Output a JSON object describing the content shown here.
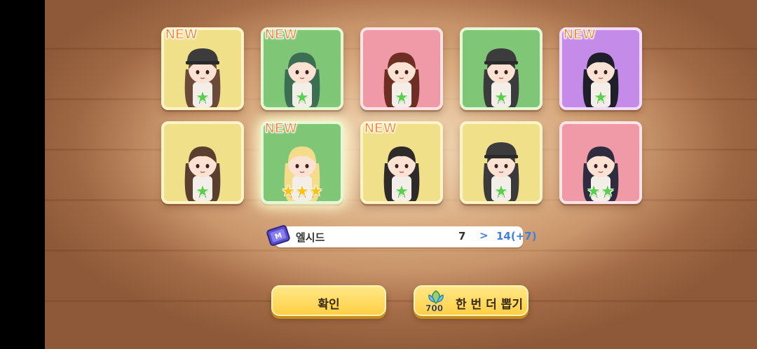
{
  "cards": [
    {
      "is_new": true,
      "new_label": "NEW",
      "stars": 1,
      "star_color": "green",
      "bg": "yellow",
      "hair": "#6b4a3a",
      "helmet": true,
      "glow": false
    },
    {
      "is_new": true,
      "new_label": "NEW",
      "stars": 1,
      "star_color": "green",
      "bg": "green",
      "hair": "#3b6e52",
      "helmet": false,
      "glow": false
    },
    {
      "is_new": false,
      "new_label": "",
      "stars": 1,
      "star_color": "green",
      "bg": "pink",
      "hair": "#6e2e24",
      "helmet": false,
      "glow": false
    },
    {
      "is_new": false,
      "new_label": "",
      "stars": 1,
      "star_color": "green",
      "bg": "green",
      "hair": "#3b3b3b",
      "helmet": true,
      "glow": false
    },
    {
      "is_new": true,
      "new_label": "NEW",
      "stars": 1,
      "star_color": "green",
      "bg": "purple",
      "hair": "#1f1f2a",
      "helmet": false,
      "glow": false
    },
    {
      "is_new": false,
      "new_label": "",
      "stars": 1,
      "star_color": "green",
      "bg": "yellow",
      "hair": "#5a3e2e",
      "helmet": false,
      "glow": false
    },
    {
      "is_new": true,
      "new_label": "NEW",
      "stars": 3,
      "star_color": "gold",
      "bg": "green",
      "hair": "#f4dc8a",
      "helmet": false,
      "glow": true
    },
    {
      "is_new": true,
      "new_label": "NEW",
      "stars": 1,
      "star_color": "green",
      "bg": "yellow",
      "hair": "#2e2a2a",
      "helmet": false,
      "glow": false
    },
    {
      "is_new": false,
      "new_label": "",
      "stars": 1,
      "star_color": "green",
      "bg": "yellow",
      "hair": "#3a3a3a",
      "helmet": true,
      "glow": false
    },
    {
      "is_new": false,
      "new_label": "",
      "stars": 2,
      "star_color": "green",
      "bg": "pink",
      "hair": "#2e2c3e",
      "helmet": false,
      "glow": false
    }
  ],
  "resource": {
    "name": "엘시드",
    "icon": "elsid-ticket-icon",
    "from": "7",
    "arrow": ">",
    "to": "14(+7)"
  },
  "buttons": {
    "confirm_label": "확인",
    "draw_again_label": "한 번 더 뽑기",
    "draw_again_cost": "700",
    "cost_icon": "leaf-crystal-icon"
  }
}
